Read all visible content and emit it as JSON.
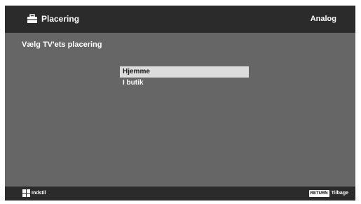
{
  "header": {
    "title": "Placering",
    "icon": "toolbox-icon",
    "source": "Analog"
  },
  "subtitle": "Vælg TV'ets placering",
  "menu": {
    "items": [
      {
        "label": "Hjemme",
        "selected": true
      },
      {
        "label": "I butik",
        "selected": false
      }
    ]
  },
  "footer": {
    "left_label": "Indstil",
    "left_icon": "grid-icon",
    "return_key": "RETURN",
    "right_label": "Tilbage"
  },
  "colors": {
    "background": "#666666",
    "bar": "#2b2b2b",
    "highlight": "#dcdcdc"
  }
}
